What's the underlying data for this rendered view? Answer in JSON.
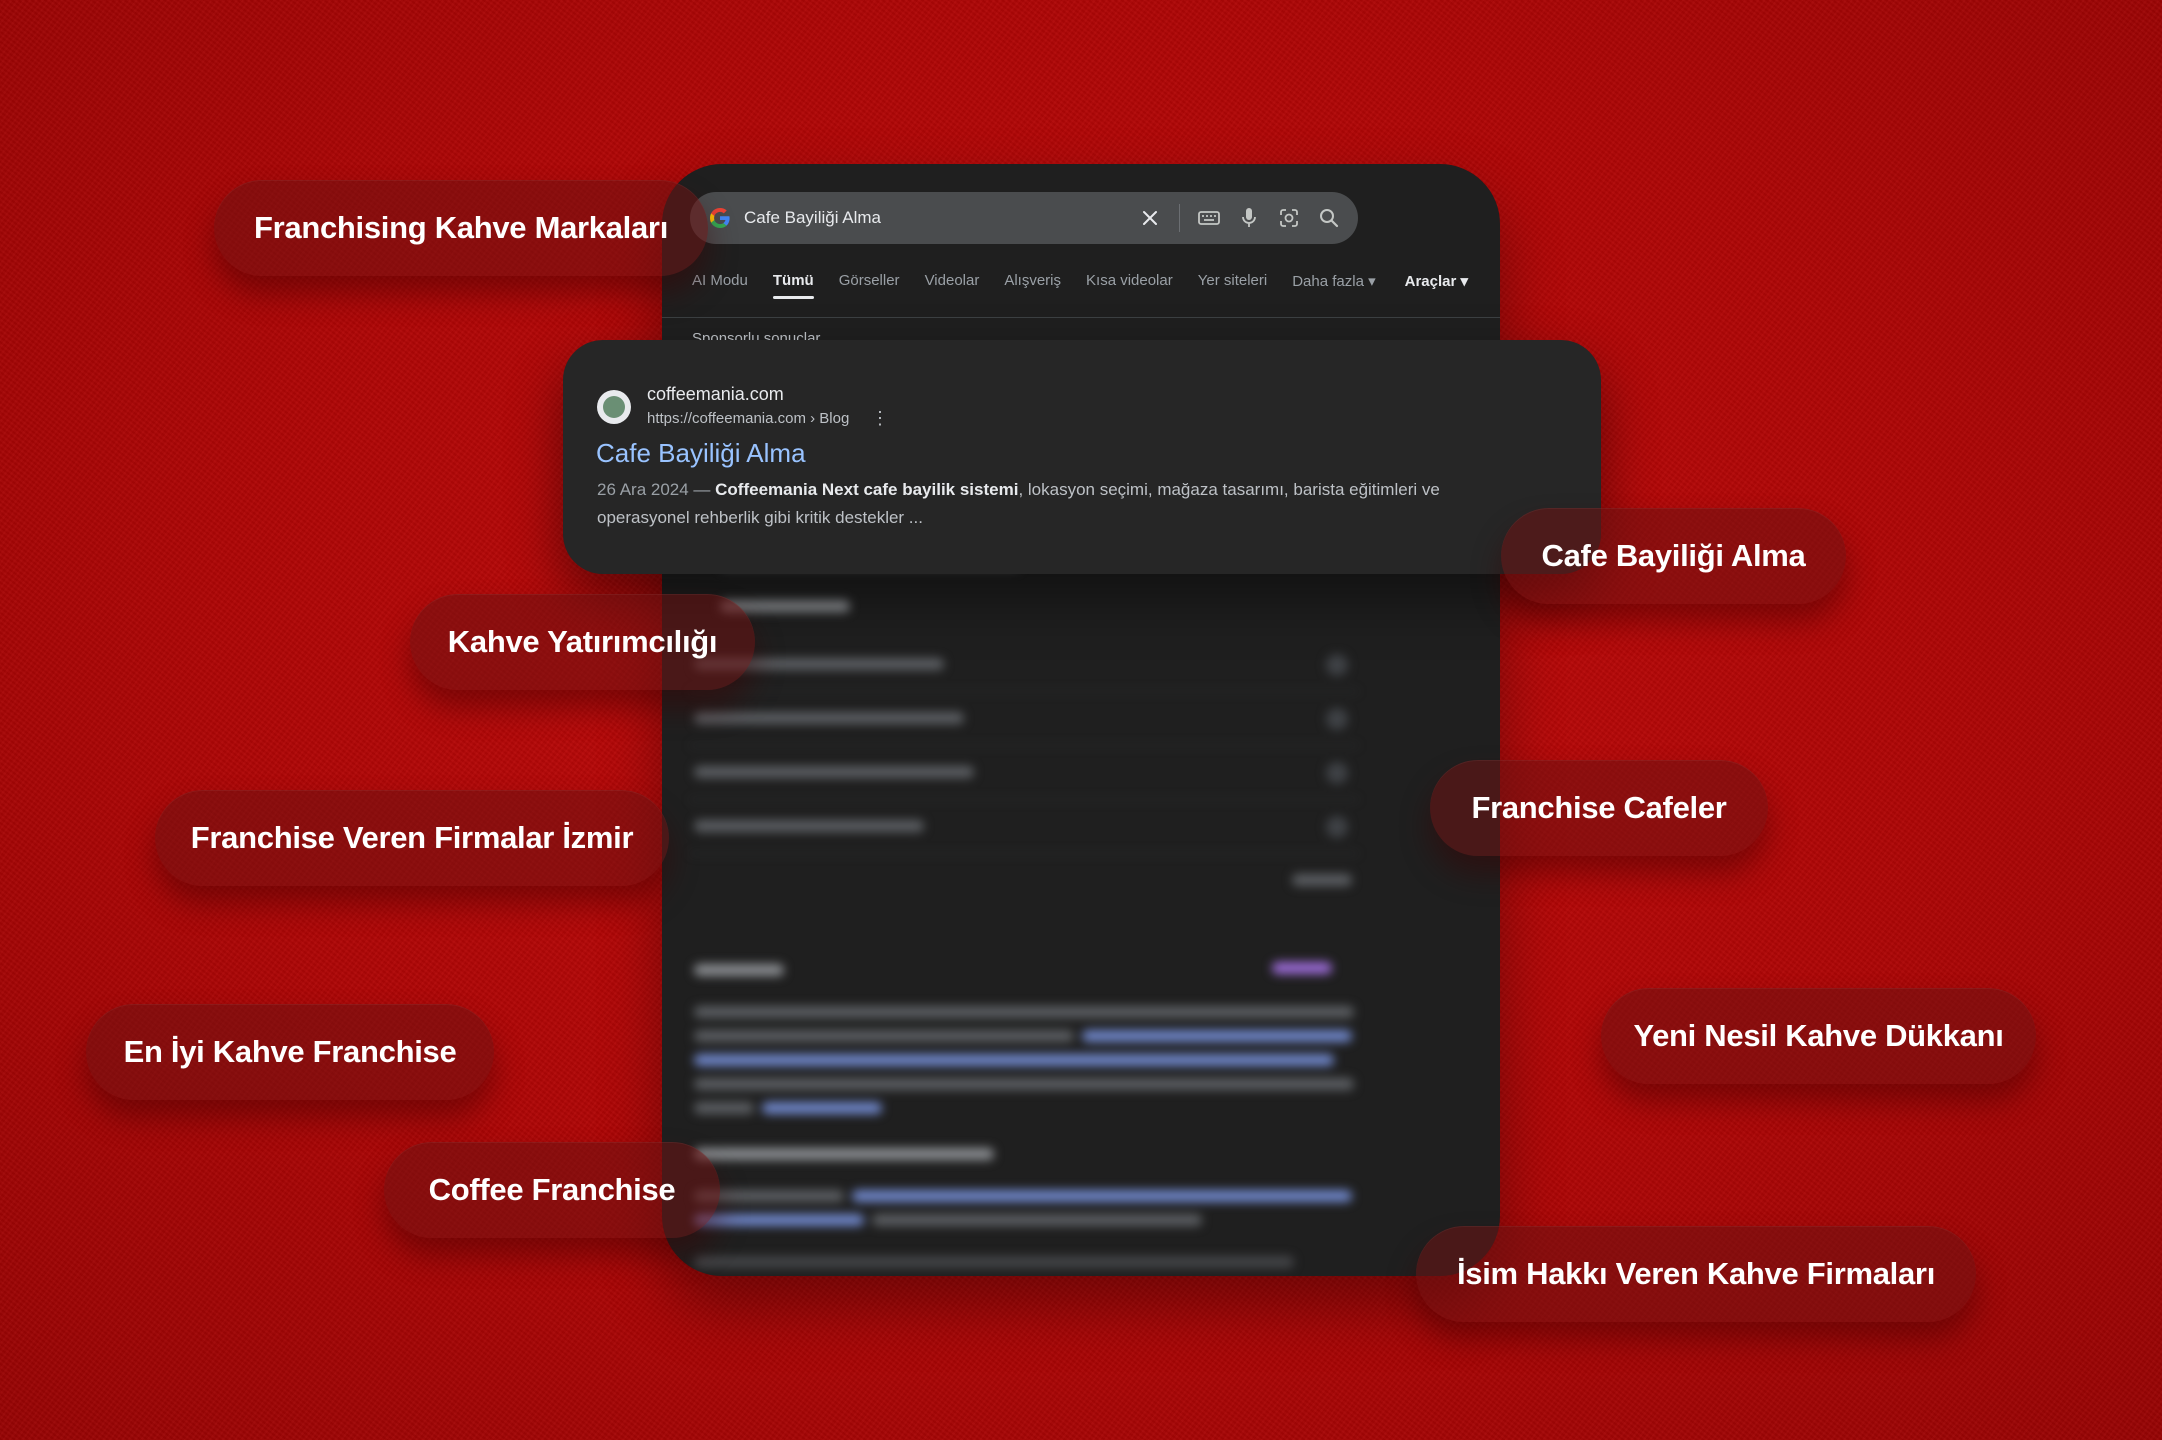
{
  "search": {
    "query": "Cafe Bayiliği Alma"
  },
  "tabs": [
    {
      "label": "AI Modu"
    },
    {
      "label": "Tümü"
    },
    {
      "label": "Görseller"
    },
    {
      "label": "Videolar"
    },
    {
      "label": "Alışveriş"
    },
    {
      "label": "Kısa videolar"
    },
    {
      "label": "Yer siteleri"
    },
    {
      "label": "Daha fazla ▾"
    },
    {
      "label": "Araçlar ▾"
    }
  ],
  "sponsored_label": "Sponsorlu sonuçlar",
  "result": {
    "site_name": "coffeemania.com",
    "url": "https://coffeemania.com › Blog",
    "title": "Cafe Bayiliği Alma",
    "date": "26 Ara 2024 — ",
    "snippet_bold": "Coffeemania Next cafe bayilik sistemi",
    "snippet_rest": ", lokasyon seçimi, mağaza tasarımı, barista eğitimleri ve operasyonel rehberlik gibi kritik destekler ..."
  },
  "keywords": [
    "Franchising Kahve Markaları",
    "Cafe Bayiliği Alma",
    "Kahve Yatırımcılığı",
    "Franchise Cafeler",
    "Franchise Veren Firmalar İzmir",
    "Yeni Nesil Kahve Dükkanı",
    "En İyi Kahve Franchise",
    "Coffee Franchise",
    "İsim Hakkı Veren Kahve Firmaları"
  ],
  "colors": {
    "background": "#b70808",
    "panel": "#1f1f1f",
    "link": "#99c3ff"
  }
}
